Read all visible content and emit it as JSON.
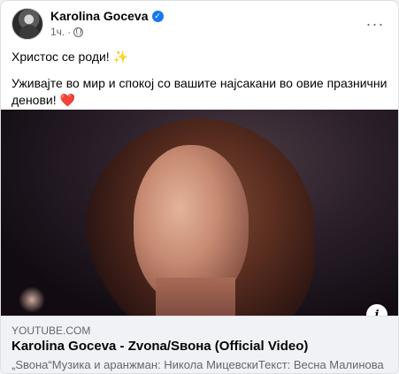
{
  "post": {
    "author": "Karolina Goceva",
    "verified_mark": "✓",
    "time": "1ч.",
    "separator": "·",
    "more_label": "···",
    "text_line1": "Христос се роди! ",
    "sparkle": "✨",
    "text_line2": "Уживајте во мир и спокој со вашите најсакани во овие празнични денови! ",
    "heart": "❤️"
  },
  "icons": {
    "verified": "verified-badge-icon",
    "audience": "globe-icon",
    "more": "more-options-icon",
    "info": "info-icon"
  },
  "link": {
    "domain": "YOUTUBE.COM",
    "title": "Karolina Goceva - Zvona/Ѕвона (Official Video)",
    "description": "„Ѕвона“Музика и аранжман: Никола МицевскиТекст: Весна Малинова",
    "info_label": "i"
  },
  "colors": {
    "brand_blue": "#1877f2",
    "secondary_text": "#65676b",
    "preview_bg": "#f0f2f5"
  }
}
